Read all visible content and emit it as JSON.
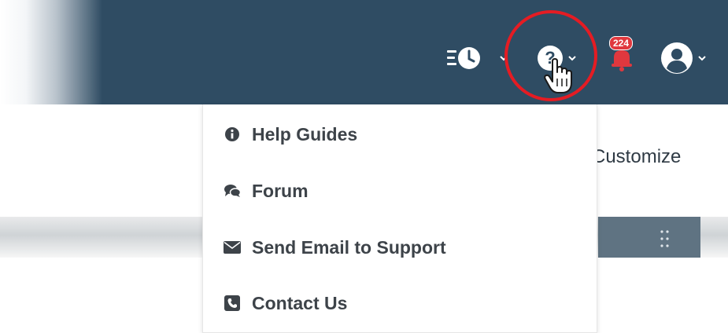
{
  "header": {
    "notifications": {
      "count": "224"
    }
  },
  "icons": {
    "history": "history-clock-icon",
    "help": "question-circle-icon",
    "notifications": "bell-icon",
    "user": "user-circle-icon"
  },
  "help_menu": {
    "items": [
      {
        "label": "Help Guides",
        "icon": "info-circle-icon"
      },
      {
        "label": "Forum",
        "icon": "comments-icon"
      },
      {
        "label": "Send Email to Support",
        "icon": "envelope-icon"
      },
      {
        "label": "Contact Us",
        "icon": "phone-square-icon"
      }
    ]
  },
  "page": {
    "customize_label": "Customize"
  },
  "colors": {
    "topbar": "#2f4c63",
    "badge": "#e0383e",
    "highlight": "#e51c23",
    "menu_text": "#3d4349"
  }
}
